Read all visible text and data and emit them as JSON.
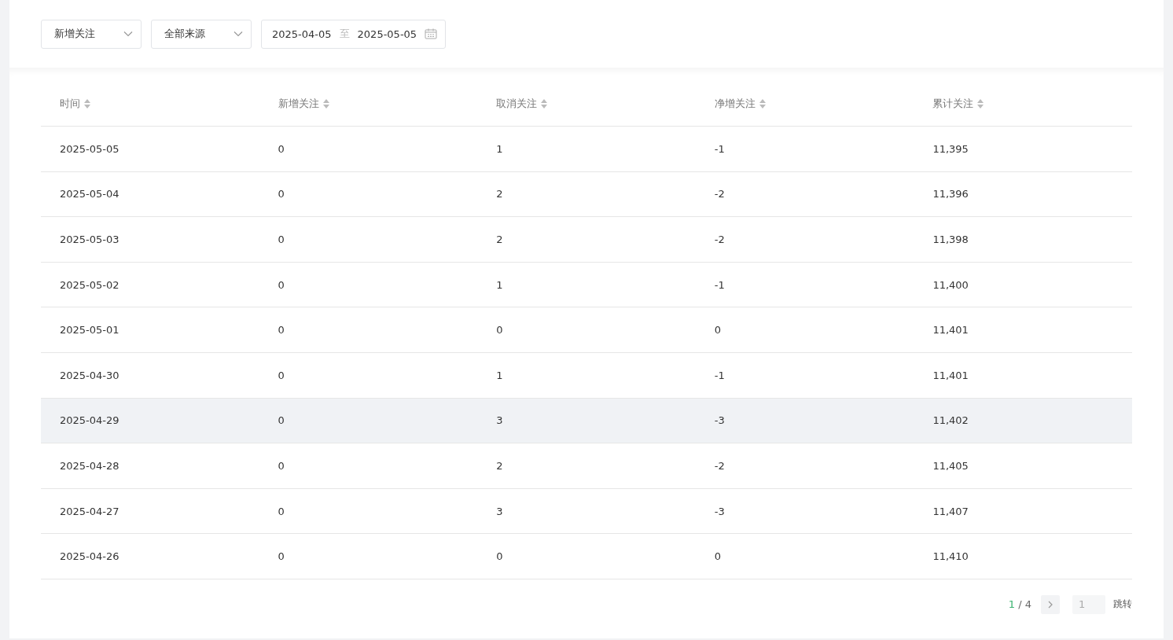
{
  "filters": {
    "type_select": {
      "value": "新增关注"
    },
    "source_select": {
      "value": "全部来源"
    },
    "date_range": {
      "start": "2025-04-05",
      "separator": "至",
      "end": "2025-05-05"
    }
  },
  "table": {
    "columns": [
      "时间",
      "新增关注",
      "取消关注",
      "净增关注",
      "累计关注"
    ],
    "rows": [
      {
        "cells": [
          "2025-05-05",
          "0",
          "1",
          "-1",
          "11,395"
        ],
        "highlighted": false
      },
      {
        "cells": [
          "2025-05-04",
          "0",
          "2",
          "-2",
          "11,396"
        ],
        "highlighted": false
      },
      {
        "cells": [
          "2025-05-03",
          "0",
          "2",
          "-2",
          "11,398"
        ],
        "highlighted": false
      },
      {
        "cells": [
          "2025-05-02",
          "0",
          "1",
          "-1",
          "11,400"
        ],
        "highlighted": false
      },
      {
        "cells": [
          "2025-05-01",
          "0",
          "0",
          "0",
          "11,401"
        ],
        "highlighted": false
      },
      {
        "cells": [
          "2025-04-30",
          "0",
          "1",
          "-1",
          "11,401"
        ],
        "highlighted": false
      },
      {
        "cells": [
          "2025-04-29",
          "0",
          "3",
          "-3",
          "11,402"
        ],
        "highlighted": true
      },
      {
        "cells": [
          "2025-04-28",
          "0",
          "2",
          "-2",
          "11,405"
        ],
        "highlighted": false
      },
      {
        "cells": [
          "2025-04-27",
          "0",
          "3",
          "-3",
          "11,407"
        ],
        "highlighted": false
      },
      {
        "cells": [
          "2025-04-26",
          "0",
          "0",
          "0",
          "11,410"
        ],
        "highlighted": false
      }
    ]
  },
  "pagination": {
    "current": "1",
    "total": "/ 4",
    "jump_field": {
      "placeholder": "1"
    },
    "jump_button": "跳转"
  }
}
